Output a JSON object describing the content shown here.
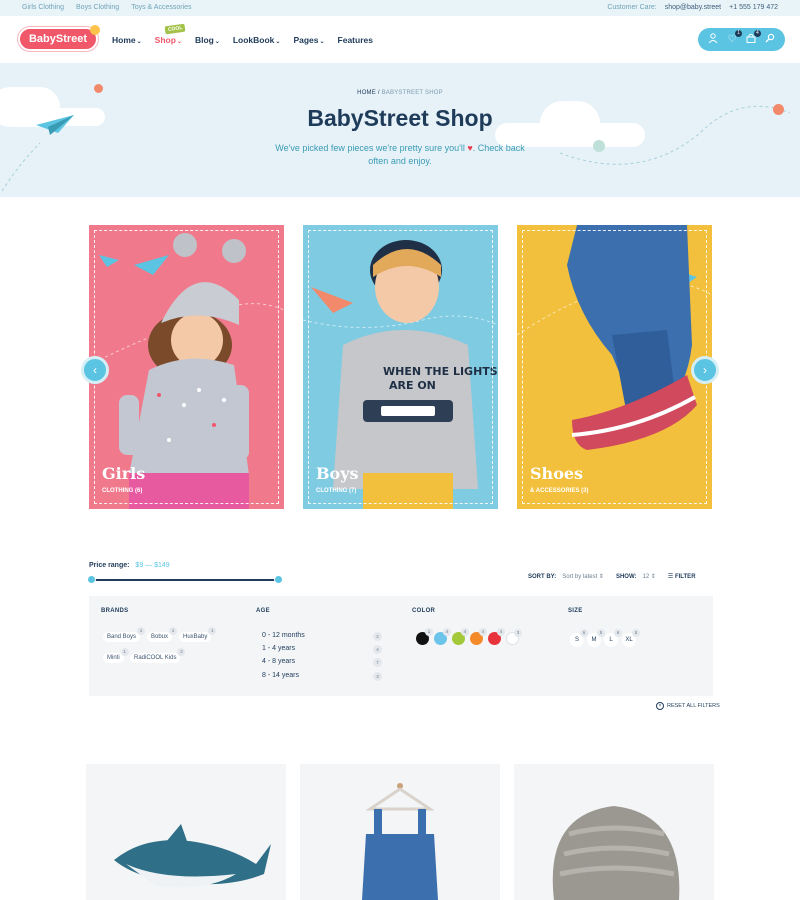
{
  "topbar": {
    "links": [
      "Girls Clothing",
      "Boys Clothing",
      "Toys & Accessories"
    ],
    "customer_care_label": "Customer Care:",
    "email": "shop@baby.street",
    "phone": "+1 555 179 472"
  },
  "header": {
    "logo_text": "BabyStreet",
    "nav": [
      {
        "label": "Home"
      },
      {
        "label": "Shop",
        "badge": "COOL"
      },
      {
        "label": "Blog"
      },
      {
        "label": "LookBook"
      },
      {
        "label": "Pages"
      },
      {
        "label": "Features"
      }
    ],
    "wishlist_count": "1",
    "cart_count": "4"
  },
  "hero": {
    "breadcrumb_home": "HOME",
    "breadcrumb_sep": "/",
    "breadcrumb_current": "BABYSTREET SHOP",
    "title": "BabyStreet Shop",
    "subtitle_a": "We've picked few pieces we're pretty sure you'll",
    "subtitle_b": ". Check back often and enjoy."
  },
  "categories": [
    {
      "title": "Girls",
      "subtitle": "CLOTHING (6)",
      "bg": "#f07a8c"
    },
    {
      "title": "Boys",
      "subtitle": "CLOTHING (7)",
      "bg": "#7ecbe2"
    },
    {
      "title": "Shoes",
      "subtitle": "& ACCESSORIES (3)",
      "bg": "#f2c03c"
    }
  ],
  "price_filter": {
    "label": "Price range:",
    "value": "$9 — $149",
    "min": 9,
    "max": 149
  },
  "sort": {
    "sort_label": "SORT BY:",
    "sort_value": "Sort by latest",
    "show_label": "SHOW:",
    "show_value": "12",
    "filter_label": "FILTER"
  },
  "filters": {
    "brands_title": "BRANDS",
    "brands": [
      {
        "name": "Band Boys",
        "count": "1"
      },
      {
        "name": "Bobux",
        "count": "1"
      },
      {
        "name": "HuxBaby",
        "count": "1"
      },
      {
        "name": "Minti",
        "count": "1"
      },
      {
        "name": "RadiCOOL Kids",
        "count": "2"
      }
    ],
    "age_title": "AGE",
    "ages": [
      {
        "label": "0 - 12 months",
        "count": "2"
      },
      {
        "label": "1 - 4 years",
        "count": "4"
      },
      {
        "label": "4 - 8 years",
        "count": "7"
      },
      {
        "label": "8 - 14 years",
        "count": "3"
      }
    ],
    "color_title": "COLOR",
    "colors": [
      {
        "hex": "#111111",
        "count": "1"
      },
      {
        "hex": "#6cc4ea",
        "count": "4"
      },
      {
        "hex": "#a3c93a",
        "count": "4"
      },
      {
        "hex": "#f58a2a",
        "count": "4"
      },
      {
        "hex": "#e8323c",
        "count": "4"
      },
      {
        "hex": "#ffffff",
        "count": "3"
      }
    ],
    "size_title": "SIZE",
    "sizes": [
      {
        "label": "S",
        "count": "6"
      },
      {
        "label": "M",
        "count": "5"
      },
      {
        "label": "L",
        "count": "6"
      },
      {
        "label": "XL",
        "count": "5"
      }
    ],
    "reset_label": "RESET ALL FILTERS"
  },
  "colors": {
    "accent": "#5bc4e3",
    "brand": "#f0586a",
    "navy": "#1f3b5a"
  }
}
